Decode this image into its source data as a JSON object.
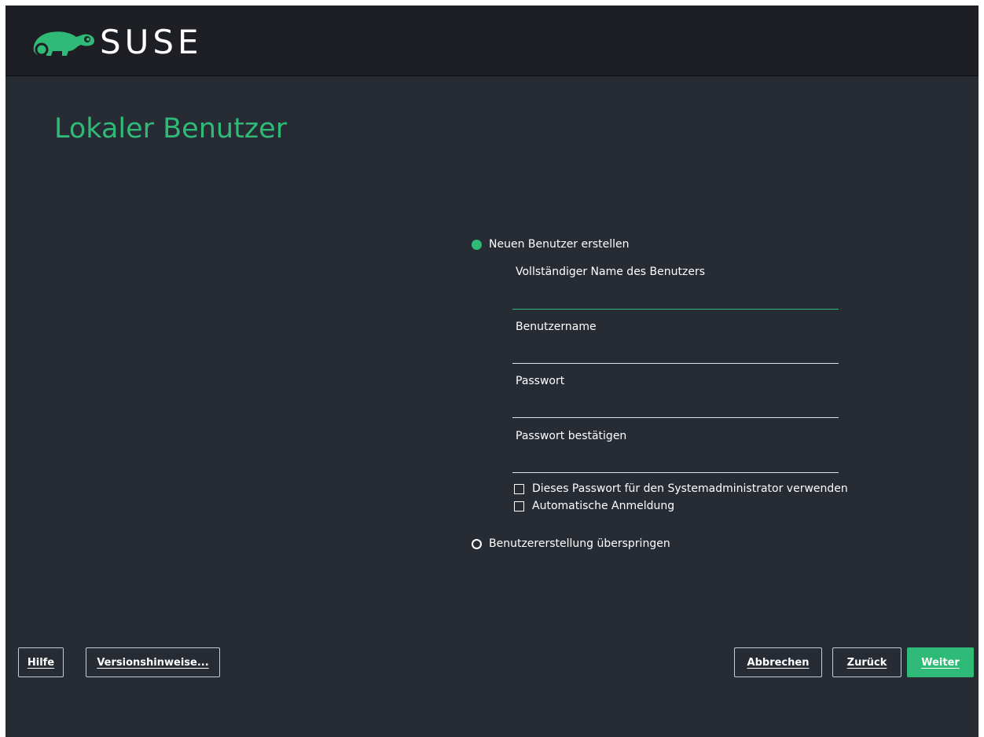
{
  "header": {
    "brand": "SUSE",
    "logo_icon": "suse-chameleon-icon"
  },
  "page": {
    "title": "Lokaler Benutzer"
  },
  "form": {
    "create_option": {
      "label": "Neuen Benutzer erstellen",
      "selected": true
    },
    "fields": {
      "fullname": {
        "label": "Vollständiger Name des Benutzers",
        "value": ""
      },
      "username": {
        "label": "Benutzername",
        "value": ""
      },
      "password": {
        "label": "Passwort",
        "value": ""
      },
      "password_confirm": {
        "label": "Passwort bestätigen",
        "value": ""
      }
    },
    "checkboxes": {
      "use_for_admin": {
        "label": "Dieses Passwort für den Systemadministrator verwenden",
        "checked": false
      },
      "auto_login": {
        "label": "Automatische Anmeldung",
        "checked": false
      }
    },
    "skip_option": {
      "label": "Benutzererstellung überspringen",
      "selected": false
    }
  },
  "footer": {
    "help": "Hilfe",
    "release_notes": "Versionshinweise...",
    "abort": "Abbrechen",
    "back": "Zurück",
    "next": "Weiter"
  },
  "colors": {
    "accent": "#30ba78",
    "background": "#272b33",
    "header": "#1d1f24",
    "text": "#ffffff"
  }
}
